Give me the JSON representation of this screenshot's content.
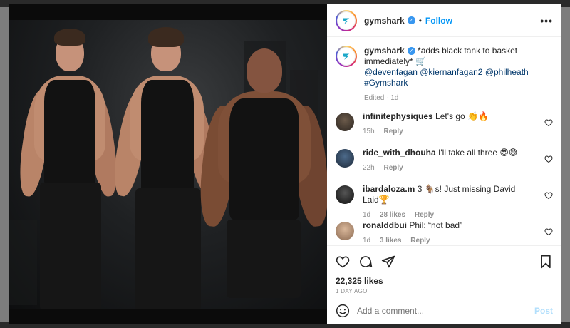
{
  "post": {
    "username": "gymshark",
    "follow_label": "Follow",
    "more_label": "•••",
    "separator": "•"
  },
  "caption": {
    "username": "gymshark",
    "text": "*adds black tank to basket immediately* 🛒",
    "tags": "@devenfagan @kiernanfagan2 @philheath #Gymshark",
    "meta": "Edited · 1d"
  },
  "comments": [
    {
      "user": "infinitephysiques",
      "text": "Let's go 👏🔥",
      "time": "15h",
      "likes": "",
      "reply": "Reply"
    },
    {
      "user": "ride_with_dhouha",
      "text": "I'll take all three 😍😅",
      "time": "22h",
      "likes": "",
      "reply": "Reply"
    },
    {
      "user": "ibardaloza.m",
      "text": "3 🐐s! Just missing David Laid🏆",
      "time": "1d",
      "likes": "28 likes",
      "reply": "Reply"
    },
    {
      "user": "ronalddbui",
      "text": "Phil: “not bad”",
      "time": "1d",
      "likes": "3 likes",
      "reply": "Reply"
    }
  ],
  "stats": {
    "likes": "22,325 likes",
    "ago": "1 DAY AGO"
  },
  "composer": {
    "placeholder": "Add a comment...",
    "post_label": "Post"
  },
  "colors": {
    "link": "#0095f6",
    "tag": "#00376b",
    "muted": "#8e8e8e",
    "post_disabled": "#b2dffc"
  }
}
